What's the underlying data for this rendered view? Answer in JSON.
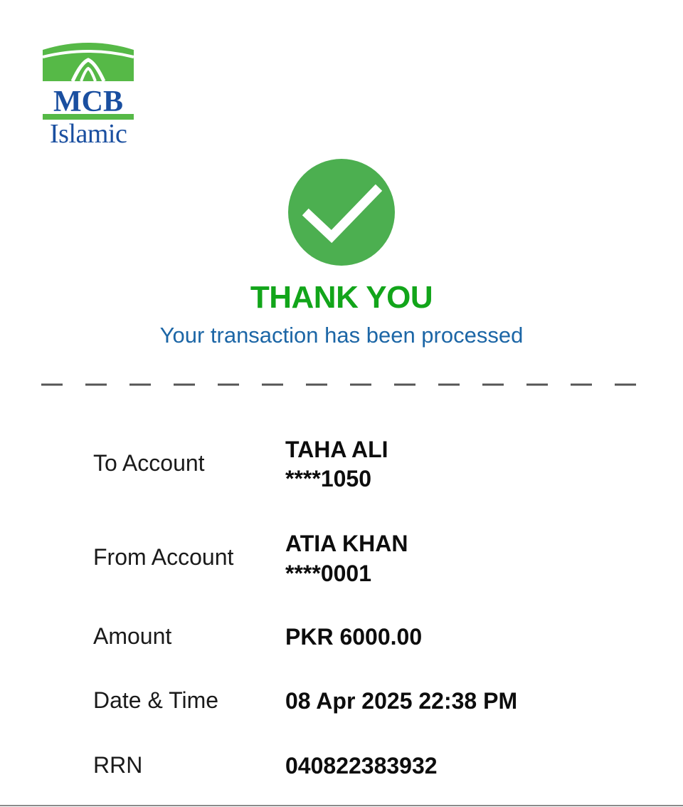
{
  "brand": {
    "logo_text": "MCB",
    "logo_subtext": "Islamic",
    "colors": {
      "green": "#56b947",
      "blue": "#1a4fa0"
    }
  },
  "status": {
    "icon": "check-circle-icon",
    "title": "THANK YOU",
    "message": "Your transaction has been processed",
    "colors": {
      "title": "#12a51a",
      "message": "#1c66a6",
      "circle": "#4caf50"
    }
  },
  "details": {
    "to_account": {
      "label": "To Account",
      "name": "TAHA ALI",
      "number": "****1050"
    },
    "from_account": {
      "label": "From Account",
      "name": "ATIA KHAN",
      "number": "****0001"
    },
    "amount": {
      "label": "Amount",
      "value": "PKR 6000.00"
    },
    "datetime": {
      "label": "Date & Time",
      "value": "08 Apr 2025 22:38 PM"
    },
    "rrn": {
      "label": "RRN",
      "value": "040822383932"
    }
  }
}
